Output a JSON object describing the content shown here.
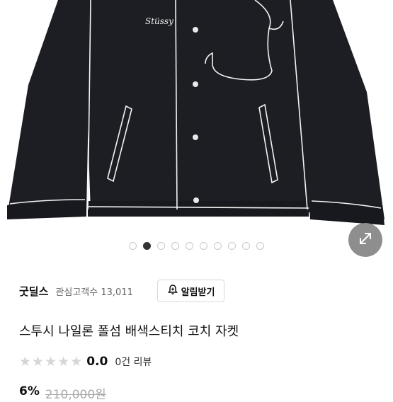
{
  "product": {
    "image_alt": "jacket-photo",
    "brand_logo": "Stüssy",
    "title": "스투시 나일론 폴섬 배색스티치 코치 자켓",
    "rating": "0.0",
    "review_count": "0건 리뷰",
    "rating_stars": 0,
    "discount": "6%",
    "original_price": "210,000원"
  },
  "gallery": {
    "total_images": 10,
    "active_index": 1
  },
  "seller": {
    "name": "굿딜스",
    "interest_label": "관심고객수",
    "interest_count": "13,011",
    "alarm_label": "알림받기"
  },
  "colors": {
    "jacket": "#1c1e24",
    "stitch": "#f2f2f2",
    "expand_bg": "#8e8e8e"
  }
}
